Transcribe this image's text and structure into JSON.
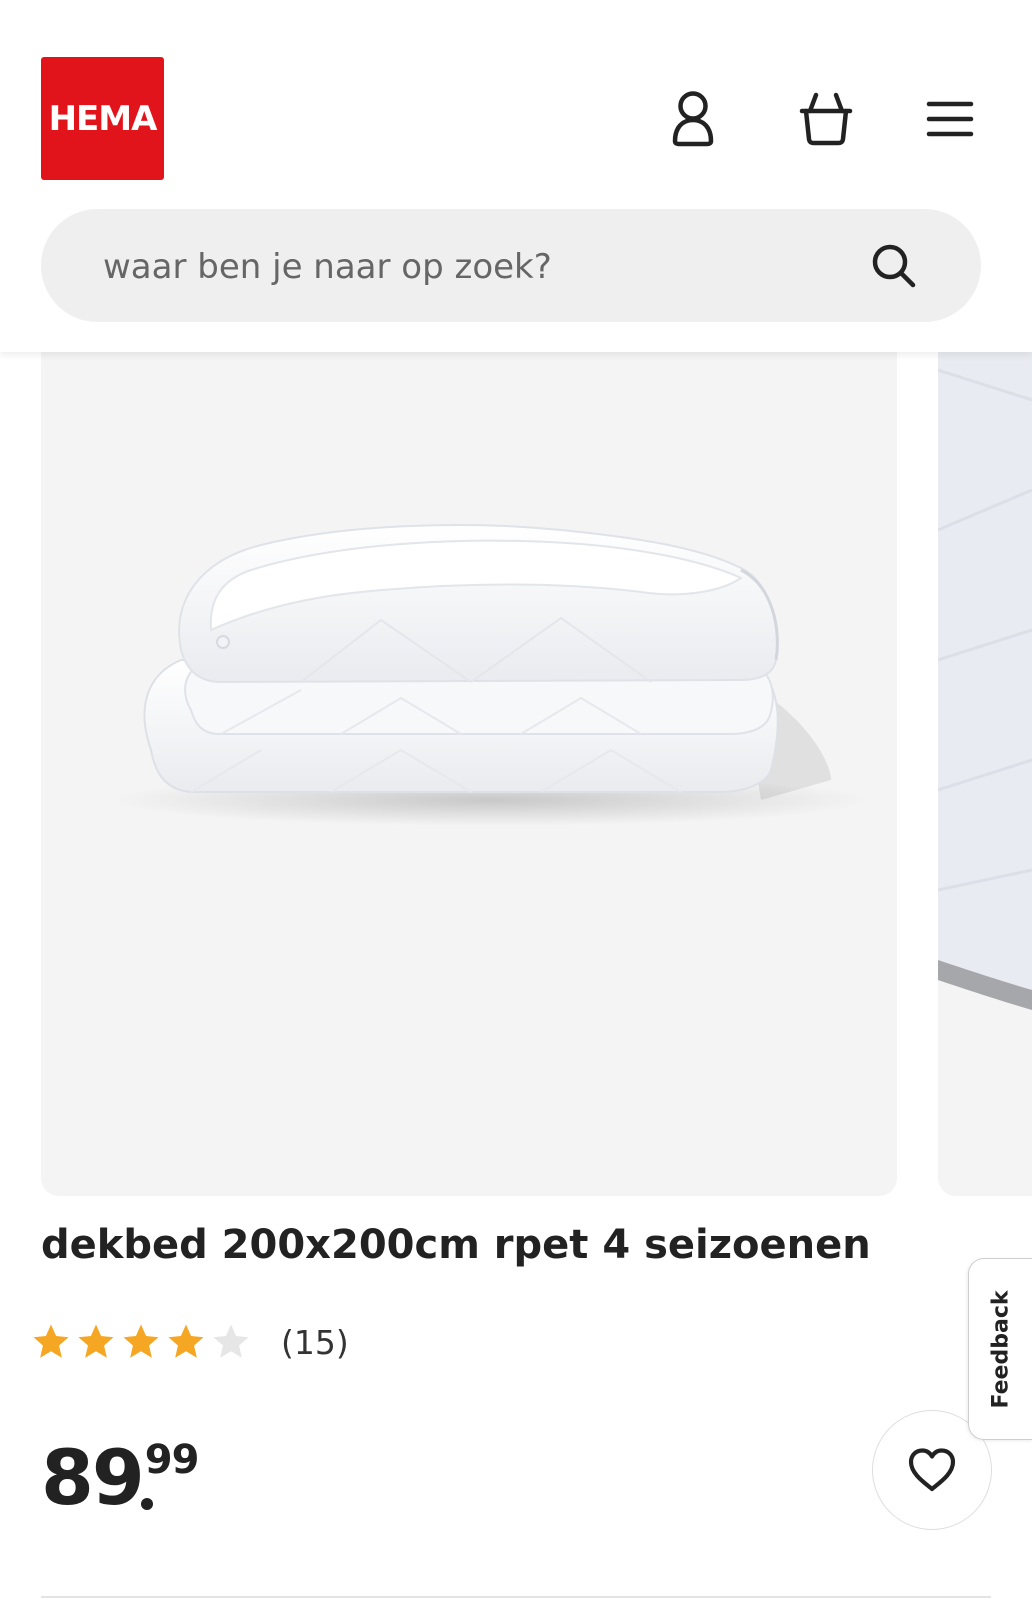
{
  "header": {
    "logo_text": "HEMA",
    "brand_color": "#e2141b",
    "icons": [
      "account-icon",
      "basket-icon",
      "menu-icon"
    ]
  },
  "search": {
    "placeholder": "waar ben je naar op zoek?",
    "icon": "search-icon"
  },
  "product": {
    "title": "dekbed 200x200cm rpet 4 seizoenen",
    "rating": {
      "value": 4,
      "max": 5,
      "review_count": "(15)",
      "star_color": "#f5a623"
    },
    "price": {
      "integer": "89",
      "cents": "99"
    }
  },
  "feedback": {
    "label": "Feedback"
  },
  "favorite": {
    "icon": "heart-icon"
  }
}
